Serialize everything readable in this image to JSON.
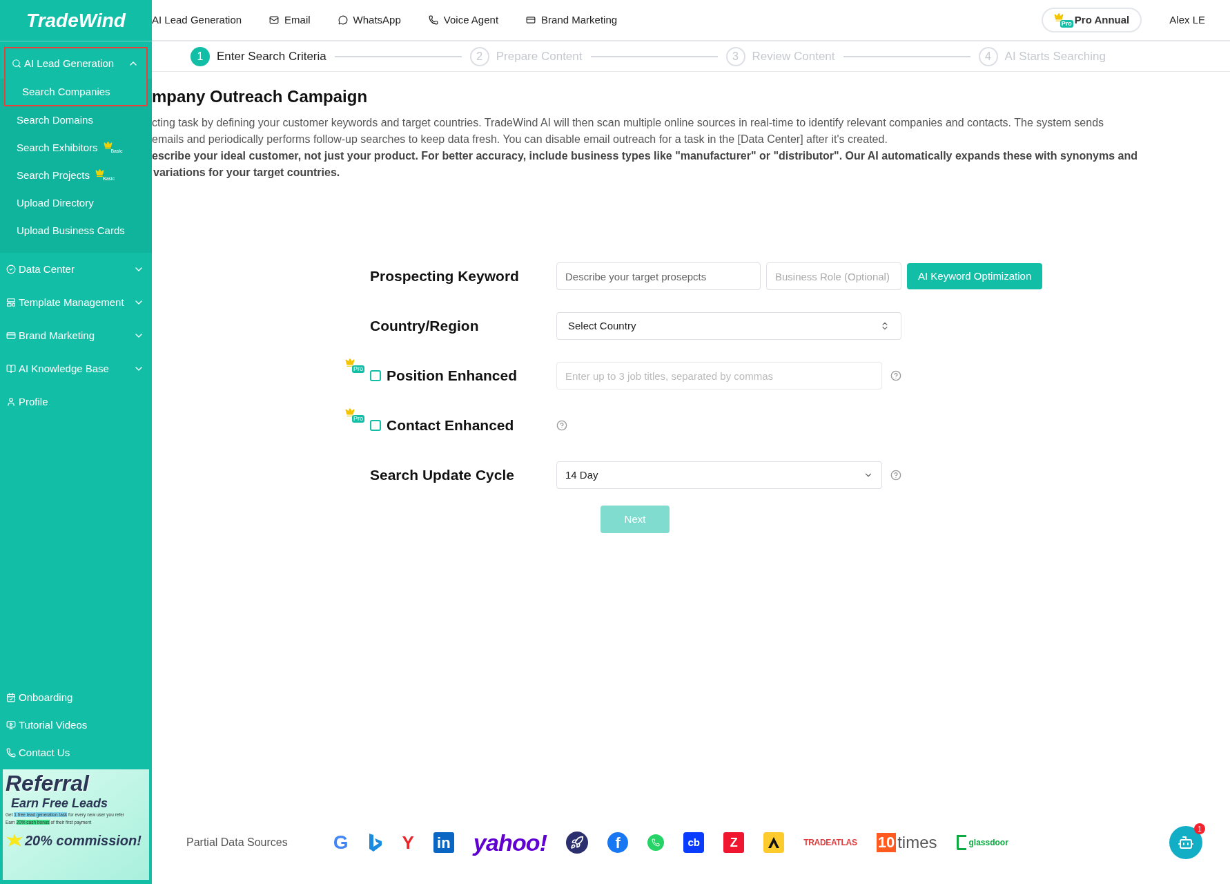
{
  "logo": "TradeWind",
  "top_nav": [
    {
      "label": "AI Lead Generation",
      "kind": "none"
    },
    {
      "label": "Email",
      "kind": "mail"
    },
    {
      "label": "WhatsApp",
      "kind": "chat"
    },
    {
      "label": "Voice Agent",
      "kind": "phone"
    },
    {
      "label": "Brand Marketing",
      "kind": "card"
    }
  ],
  "plan": {
    "badge": "Pro",
    "label": "Pro Annual"
  },
  "user": "Alex LE",
  "sidebar": {
    "items": [
      {
        "label": "AI Lead Generation",
        "kind": "search",
        "expanded": true,
        "highlighted": true,
        "children": [
          {
            "label": "Search Companies",
            "selected": true
          },
          {
            "label": "Search Domains",
            "selected": false
          },
          {
            "label": "Search Exhibitors",
            "selected": false,
            "badge": "Basic"
          },
          {
            "label": "Search Projects",
            "selected": false,
            "badge": "Basic"
          },
          {
            "label": "Upload Directory",
            "selected": false
          },
          {
            "label": "Upload Business Cards",
            "selected": false
          }
        ]
      },
      {
        "label": "Data Center",
        "kind": "check",
        "expanded": false
      },
      {
        "label": "Template Management",
        "kind": "layout",
        "expanded": false
      },
      {
        "label": "Brand Marketing",
        "kind": "card",
        "expanded": false
      },
      {
        "label": "AI Knowledge Base",
        "kind": "book",
        "expanded": false
      },
      {
        "label": "Profile",
        "kind": "user"
      }
    ],
    "bottom_links": [
      {
        "label": "Onboarding",
        "kind": "calendar"
      },
      {
        "label": "Tutorial Videos",
        "kind": "video"
      },
      {
        "label": "Contact Us",
        "kind": "phone"
      }
    ],
    "referral": {
      "title": "Referral",
      "subtitle": "Earn Free Leads",
      "lines": [
        [
          {
            "text": "Get "
          },
          {
            "text": "1 free lead generation task",
            "color": "#7fd8ef"
          },
          {
            "text": " for every new user you refer"
          }
        ],
        [
          {
            "text": "Earn "
          },
          {
            "text": "20% cash bonus",
            "color": "#3ce08a"
          },
          {
            "text": " of their first payment"
          }
        ]
      ],
      "commission": "20% commission!"
    }
  },
  "steps": [
    {
      "number": "1",
      "label": "Enter Search Criteria",
      "selected": true
    },
    {
      "number": "2",
      "label": "Prepare Content",
      "selected": false
    },
    {
      "number": "3",
      "label": "Review Content",
      "selected": false
    },
    {
      "number": "4",
      "label": "AI Starts Searching",
      "selected": false
    }
  ],
  "page_title": "mpany Outreach Campaign",
  "description": [
    "cting task by defining your customer keywords and target countries. TradeWind AI will then scan multiple online sources in real-time to identify relevant companies and contacts. The system sends",
    "emails and periodically performs follow-up searches to keep data fresh. You can disable email outreach for a task in the [Data Center] after it's created."
  ],
  "tip": [
    "escribe your ideal customer, not just your product. For better accuracy, include business types like \"manufacturer\" or \"distributor\". Our AI automatically expands these with synonyms and",
    "variations for your target countries."
  ],
  "form": {
    "rows": [
      {
        "kind": "keyword",
        "label": "Prospecting Keyword",
        "placeholder": "Describe your target prosepcts",
        "role_placeholder": "Business Role (Optional)",
        "button": "AI Keyword Optimization"
      },
      {
        "kind": "select",
        "label": "Country/Region",
        "value": "Select Country"
      },
      {
        "kind": "check_input",
        "label": "Position Enhanced",
        "badge": "Pro",
        "checked": false,
        "placeholder": "Enter up to 3 job titles, separated by commas"
      },
      {
        "kind": "check",
        "label": "Contact Enhanced",
        "badge": "Pro",
        "checked": false
      },
      {
        "kind": "dropdown",
        "label": "Search Update Cycle",
        "value": "14 Day"
      }
    ],
    "next": {
      "label": "Next",
      "disabled": true
    }
  },
  "data_sources": {
    "label": "Partial Data Sources",
    "items": [
      {
        "kind": "google",
        "label": "G"
      },
      {
        "kind": "bing"
      },
      {
        "kind": "yandex",
        "label": "Y"
      },
      {
        "kind": "linkedin",
        "label": "in"
      },
      {
        "kind": "yahoo",
        "label": "yahoo!"
      },
      {
        "kind": "rocket"
      },
      {
        "kind": "facebook",
        "label": "f"
      },
      {
        "kind": "whatsapp"
      },
      {
        "kind": "crunchbase",
        "label": "cb"
      },
      {
        "kind": "zoominfo",
        "label": "Z"
      },
      {
        "kind": "apollo"
      },
      {
        "kind": "tradeatlas",
        "label": "TRADEATLAS"
      },
      {
        "kind": "tentimes",
        "label": "10",
        "label2": "times"
      },
      {
        "kind": "glassdoor",
        "label": "glassdoor"
      }
    ]
  },
  "chat": {
    "count": "1"
  }
}
